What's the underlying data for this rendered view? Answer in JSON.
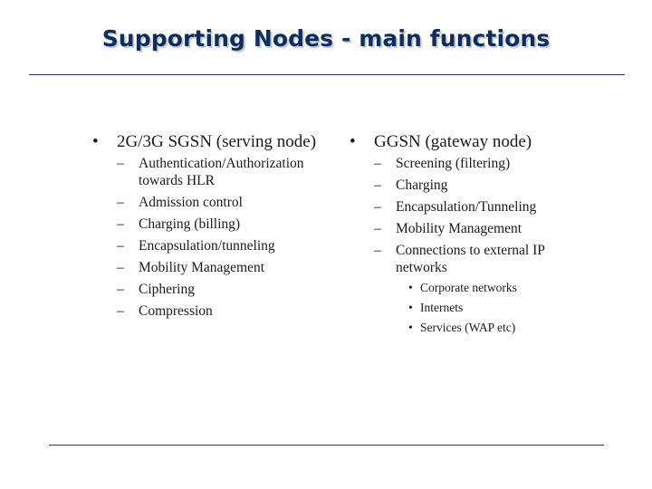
{
  "slide": {
    "title": "Supporting Nodes - main functions",
    "colors": {
      "title": "#0e2f5e",
      "rule": "#2f2f66",
      "text": "#1a1a1a"
    },
    "bullet_markers": {
      "level1": "•",
      "level2": "–",
      "level3": "•"
    },
    "columns": [
      {
        "heading": "2G/3G SGSN (serving node)",
        "items": [
          {
            "text": "Authentication/Authorization towards HLR"
          },
          {
            "text": "Admission control"
          },
          {
            "text": "Charging (billing)"
          },
          {
            "text": "Encapsulation/tunneling"
          },
          {
            "text": "Mobility Management"
          },
          {
            "text": "Ciphering"
          },
          {
            "text": "Compression"
          }
        ]
      },
      {
        "heading": "GGSN (gateway node)",
        "items": [
          {
            "text": "Screening (filtering)"
          },
          {
            "text": "Charging"
          },
          {
            "text": "Encapsulation/Tunneling"
          },
          {
            "text": "Mobility Management"
          },
          {
            "text": "Connections to external IP networks",
            "subitems": [
              "Corporate networks",
              "Internets",
              "Services (WAP etc)"
            ]
          }
        ]
      }
    ]
  }
}
